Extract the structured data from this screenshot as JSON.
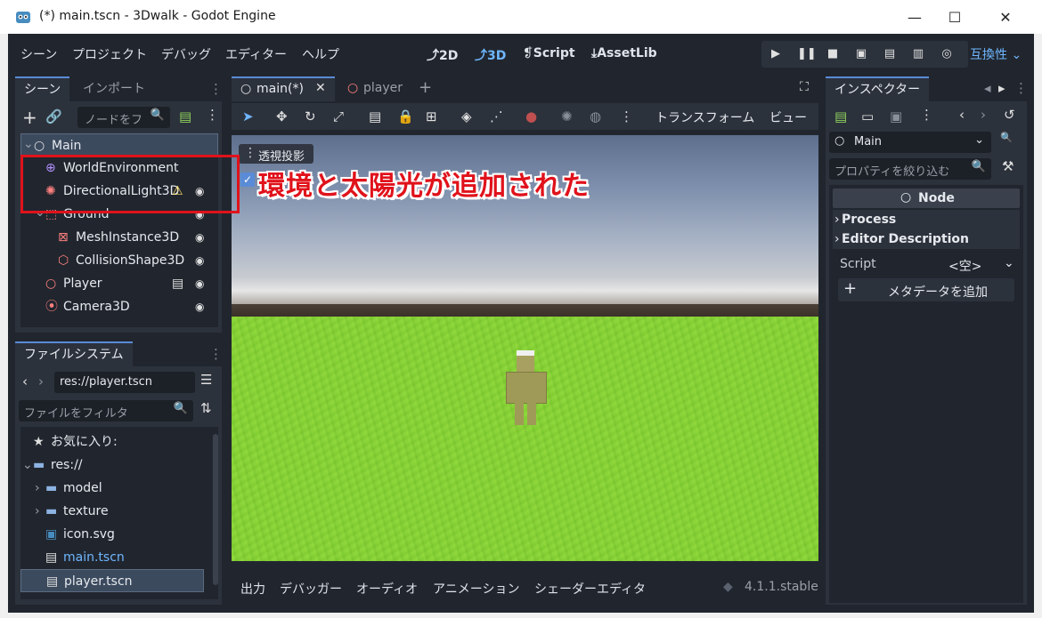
{
  "window": {
    "title": "(*) main.tscn - 3Dwalk - Godot Engine",
    "minimize": "—",
    "maximize": "☐",
    "close": "✕"
  },
  "menubar": {
    "items": [
      "シーン",
      "プロジェクト",
      "デバッグ",
      "エディター",
      "ヘルプ"
    ],
    "workspaces": [
      {
        "label": "2D",
        "icon": "2d-icon",
        "active": false
      },
      {
        "label": "3D",
        "icon": "3d-icon",
        "active": true
      },
      {
        "label": "Script",
        "icon": "script-icon",
        "active": false
      },
      {
        "label": "AssetLib",
        "icon": "assetlib-icon",
        "active": false
      }
    ],
    "renderer": "互換性"
  },
  "scene_dock": {
    "tabs": [
      "シーン",
      "インポート"
    ],
    "filter_placeholder": "ノードをフ",
    "nodes": [
      {
        "name": "Main",
        "icon": "node-circle-icon",
        "depth": 0,
        "selected": true,
        "visible_toggle": false
      },
      {
        "name": "WorldEnvironment",
        "icon": "globe-icon",
        "depth": 1,
        "visible_toggle": false
      },
      {
        "name": "DirectionalLight3D",
        "icon": "sun-icon",
        "depth": 1,
        "warning": true,
        "visible_toggle": true
      },
      {
        "name": "Ground",
        "icon": "node3d-icon",
        "depth": 1,
        "visible_toggle": true
      },
      {
        "name": "MeshInstance3D",
        "icon": "mesh-icon",
        "depth": 2,
        "visible_toggle": true
      },
      {
        "name": "CollisionShape3D",
        "icon": "collision-icon",
        "depth": 2,
        "visible_toggle": true
      },
      {
        "name": "Player",
        "icon": "node-circle-icon",
        "depth": 1,
        "visible_toggle": true,
        "scene_icon": true
      },
      {
        "name": "Camera3D",
        "icon": "camera-icon",
        "depth": 1,
        "visible_toggle": true
      }
    ]
  },
  "filesystem_dock": {
    "tab": "ファイルシステム",
    "path": "res://player.tscn",
    "filter_placeholder": "ファイルをフィルタ",
    "items": [
      {
        "label": "お気に入り:",
        "icon": "star-icon",
        "depth": 0
      },
      {
        "label": "res://",
        "icon": "folder-icon",
        "depth": 0
      },
      {
        "label": "model",
        "icon": "folder-icon",
        "depth": 1
      },
      {
        "label": "texture",
        "icon": "folder-icon",
        "depth": 1
      },
      {
        "label": "icon.svg",
        "icon": "godot-icon",
        "depth": 1
      },
      {
        "label": "main.tscn",
        "icon": "scene-icon",
        "depth": 1,
        "highlight": true
      },
      {
        "label": "player.tscn",
        "icon": "scene-icon",
        "depth": 1,
        "selected": true
      }
    ]
  },
  "editor_tabs": {
    "tabs": [
      {
        "label": "main(*)",
        "active": true
      },
      {
        "label": "player",
        "active": false
      }
    ]
  },
  "viewport_toolbar": {
    "transform": "トランスフォーム",
    "view": "ビュー"
  },
  "viewport": {
    "perspective_label": "透視投影"
  },
  "bottom_panel": {
    "tabs": [
      "出力",
      "デバッガー",
      "オーディオ",
      "アニメーション",
      "シェーダーエディタ"
    ],
    "version": "4.1.1.stable"
  },
  "inspector": {
    "tab": "インスペクター",
    "node_name": "Main",
    "filter_placeholder": "プロパティを絞り込む",
    "class_header": "Node",
    "sections": [
      "Process",
      "Editor Description"
    ],
    "script_label": "Script",
    "script_value": "<空>",
    "add_metadata": "メタデータを追加"
  },
  "annotation": {
    "text": "環境と太陽光が追加された"
  },
  "colors": {
    "accent": "#5a8bd6",
    "annotation_red": "#e0121b",
    "node_red": "#fc7f7f",
    "folder_blue": "#8db3e2"
  }
}
